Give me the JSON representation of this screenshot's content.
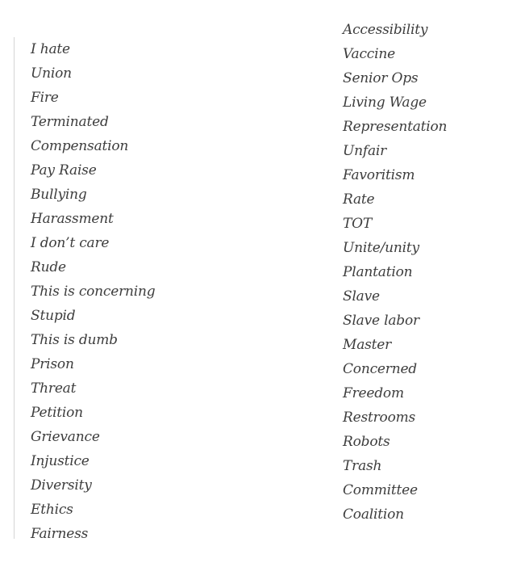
{
  "left_column": {
    "items": [
      "I hate",
      "Union",
      "Fire",
      "Terminated",
      "Compensation",
      "Pay Raise",
      "Bullying",
      "Harassment",
      "I don’t care",
      "Rude",
      "This is concerning",
      "Stupid",
      "This is dumb",
      "Prison",
      "Threat",
      "Petition",
      "Grievance",
      "Injustice",
      "Diversity",
      "Ethics",
      "Fairness"
    ]
  },
  "right_column": {
    "items": [
      "Accessibility",
      "Vaccine",
      "Senior Ops",
      "Living Wage",
      "Representation",
      "Unfair",
      "Favoritism",
      "Rate",
      "TOT",
      "Unite/unity",
      "Plantation",
      "Slave",
      "Slave labor",
      "Master",
      "Concerned",
      "Freedom",
      "Restrooms",
      "Robots",
      "Trash",
      "Committee",
      "Coalition"
    ]
  },
  "colors": {
    "text": "#3d3d3d",
    "rule": "#d4d4d4",
    "background": "#ffffff"
  }
}
